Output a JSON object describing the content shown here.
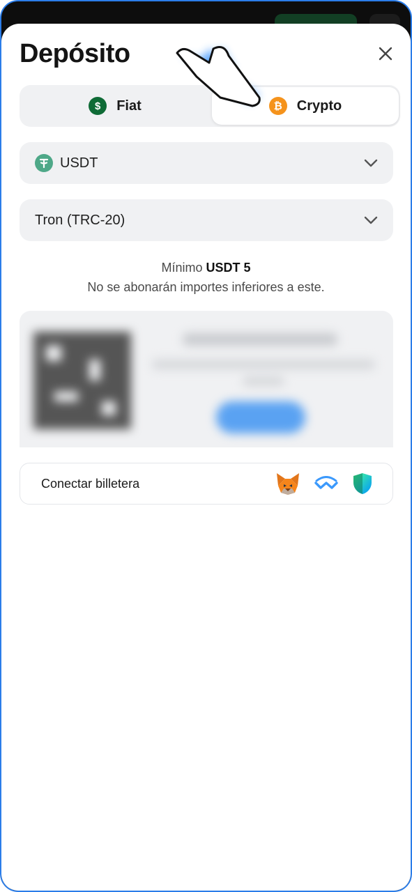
{
  "modal": {
    "title": "Depósito"
  },
  "tabs": [
    {
      "label": "Fiat",
      "icon": "dollar-coin-icon",
      "selected": false
    },
    {
      "label": "Crypto",
      "icon": "bitcoin-icon",
      "selected": true
    }
  ],
  "currency_select": {
    "value": "USDT",
    "icon": "tether-icon"
  },
  "network_select": {
    "value": "Tron (TRC-20)"
  },
  "minimum": {
    "prefix": "Mínimo",
    "amount": "USDT 5",
    "note": "No se abonarán importes inferiores a este."
  },
  "wallet_connect": {
    "label": "Conectar billetera",
    "icons": [
      "metamask-fox-icon",
      "walletconnect-icon",
      "trust-wallet-shield-icon"
    ]
  },
  "colors": {
    "accent_green": "#0f6b36",
    "bitcoin_orange": "#f5931c",
    "tether_green": "#4ea888",
    "frame_blue": "#2b7de9"
  }
}
